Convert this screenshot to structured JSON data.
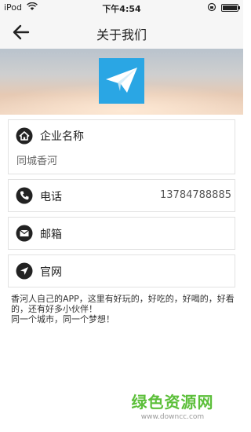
{
  "status_bar": {
    "carrier": "iPod",
    "time": "下午4:54"
  },
  "nav": {
    "title": "关于我们",
    "back_icon": "arrow-left-icon"
  },
  "banner": {
    "logo_icon": "paper-plane-icon",
    "logo_color": "#2aa6e4"
  },
  "company": {
    "label": "企业名称",
    "value": "同城香河",
    "icon": "home-icon"
  },
  "phone": {
    "label": "电话",
    "value": "13784788885",
    "icon": "phone-icon"
  },
  "email": {
    "label": "邮箱",
    "icon": "mail-icon"
  },
  "website": {
    "label": "官网",
    "icon": "location-arrow-icon"
  },
  "description": {
    "line1": "香河人自己的APP，这里有好玩的，好吃的，好喝的，好看的，还有好多小伙伴！",
    "line2": "同一个城市，同一个梦想！"
  },
  "watermark": {
    "title": "绿色资源网",
    "url": "www.downcc.com"
  }
}
